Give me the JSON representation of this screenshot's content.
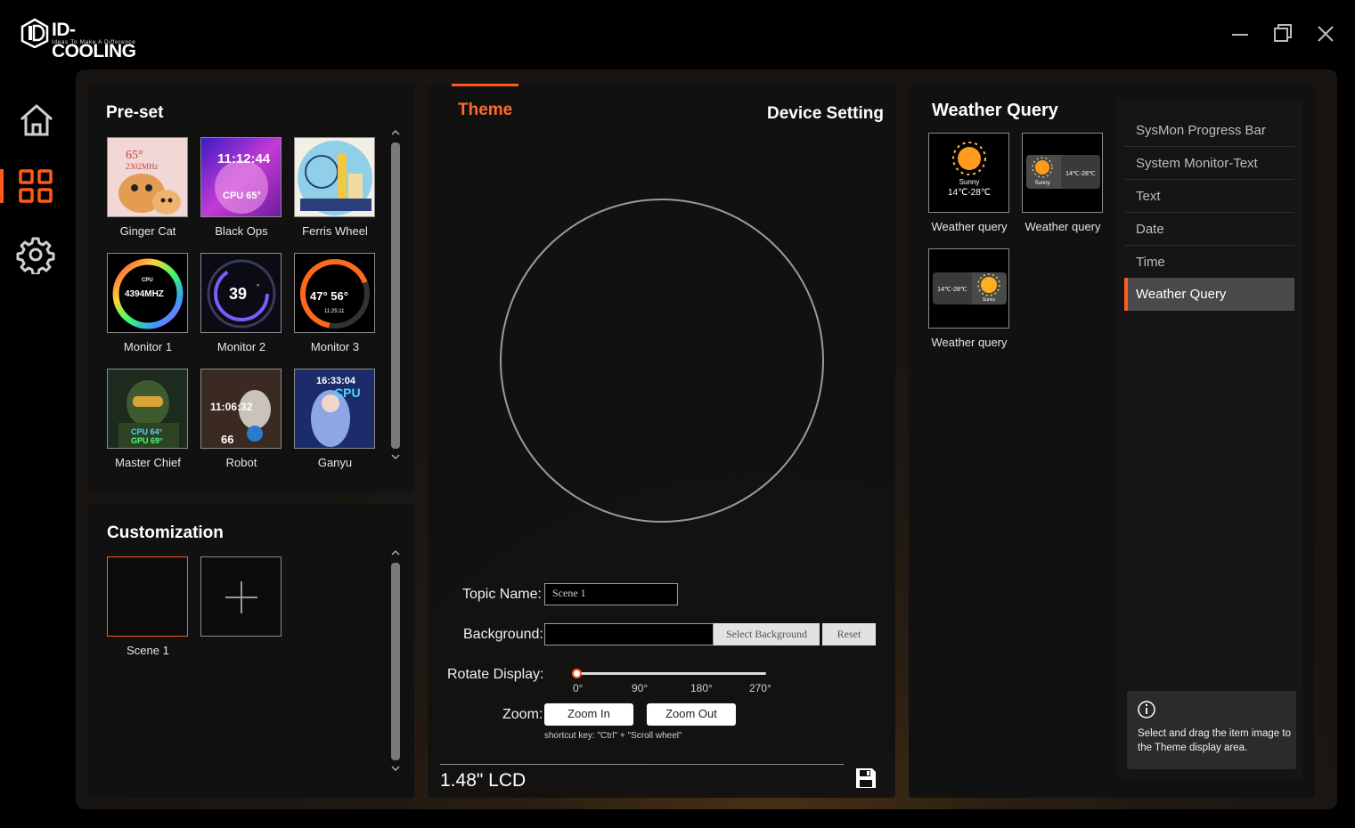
{
  "app": {
    "brand": "ID-COOLING",
    "tagline": "Ideas To Make A Difference"
  },
  "window": {
    "minimize": "minimize-icon",
    "maximize": "maximize-icon",
    "close": "close-icon"
  },
  "nav": [
    {
      "name": "home",
      "icon": "home-icon"
    },
    {
      "name": "themes",
      "icon": "grid-icon",
      "active": true
    },
    {
      "name": "settings",
      "icon": "gear-icon"
    }
  ],
  "colors": {
    "accent": "#ff5a1a",
    "panel": "#111111",
    "frame": "#1b1713"
  },
  "preset": {
    "title": "Pre-set",
    "items": [
      {
        "label": "Ginger Cat",
        "overlay": "65°",
        "overlay2": "2302MHz"
      },
      {
        "label": "Black Ops",
        "overlay": "11:12:44",
        "overlay2": "CPU 65°"
      },
      {
        "label": "Ferris Wheel",
        "overlay": "",
        "overlay2": ""
      },
      {
        "label": "Monitor 1",
        "overlay": "4394MHZ",
        "overlay2": "CPU"
      },
      {
        "label": "Monitor 2",
        "overlay": "39",
        "overlay2": "°"
      },
      {
        "label": "Monitor 3",
        "overlay": "47° 56°",
        "overlay2": "11:25:11"
      },
      {
        "label": "Master Chief",
        "overlay": "CPU 64°",
        "overlay2": "GPU 69°"
      },
      {
        "label": "Robot",
        "overlay": "11:06:32",
        "overlay2": "66"
      },
      {
        "label": "Ganyu",
        "overlay": "16:33:04",
        "overlay2": "CPU"
      }
    ]
  },
  "customization": {
    "title": "Customization",
    "items": [
      {
        "label": "Scene 1"
      }
    ],
    "add_icon": "plus-icon"
  },
  "center": {
    "tab_theme": "Theme",
    "tab_device": "Device Setting",
    "topic_label": "Topic Name:",
    "topic_value": "Scene 1",
    "background_label": "Background:",
    "background_value": "",
    "select_background": "Select Background",
    "reset": "Reset",
    "rotate_label": "Rotate Display:",
    "rotate_ticks": [
      "0°",
      "90°",
      "180°",
      "270°"
    ],
    "rotate_value": "0°",
    "zoom_label": "Zoom:",
    "zoom_in": "Zoom In",
    "zoom_out": "Zoom Out",
    "shortcut_hint": "shortcut key:  \"Ctrl\" + \"Scroll wheel\"",
    "device": "1.48\" LCD",
    "save_icon": "save-icon"
  },
  "weather": {
    "title": "Weather Query",
    "items": [
      {
        "label": "Weather query",
        "condition": "Sunny",
        "temp": "14℃-28℃"
      },
      {
        "label": "Weather query",
        "condition": "Sunny",
        "temp": "14℃-28℃"
      },
      {
        "label": "Weather query",
        "condition": "Sunny",
        "temp": "14℃-28℃"
      }
    ]
  },
  "sidebar": {
    "items": [
      {
        "label": "SysMon Progress Bar"
      },
      {
        "label": "System Monitor-Text"
      },
      {
        "label": "Text"
      },
      {
        "label": "Date"
      },
      {
        "label": "Time"
      },
      {
        "label": "Weather Query",
        "active": true
      }
    ],
    "info": "Select and drag the item image to the Theme display area.",
    "info_icon": "info-icon"
  }
}
